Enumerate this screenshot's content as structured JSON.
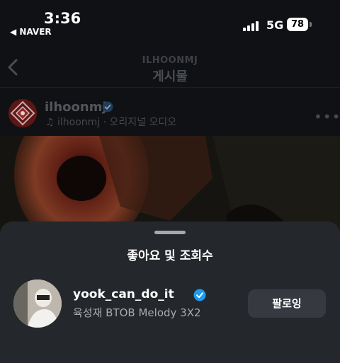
{
  "status_bar": {
    "time": "3:36",
    "back_app": "◀ NAVER",
    "network": "5G",
    "battery": "78"
  },
  "header": {
    "username": "ILHOONMJ",
    "title": "게시물"
  },
  "post": {
    "author": "ilhoonmj",
    "audio": "ilhoonmj · 오리지널 오디오"
  },
  "sheet": {
    "title": "좋아요 및 조회수",
    "rows": [
      {
        "username": "yook_can_do_it",
        "full_name": "육성재 BTOB Melody 3X2",
        "button": "팔로잉"
      }
    ]
  },
  "colors": {
    "verified": "#1d9bf0",
    "background": "#0f1114",
    "sheet": "#24272b"
  }
}
